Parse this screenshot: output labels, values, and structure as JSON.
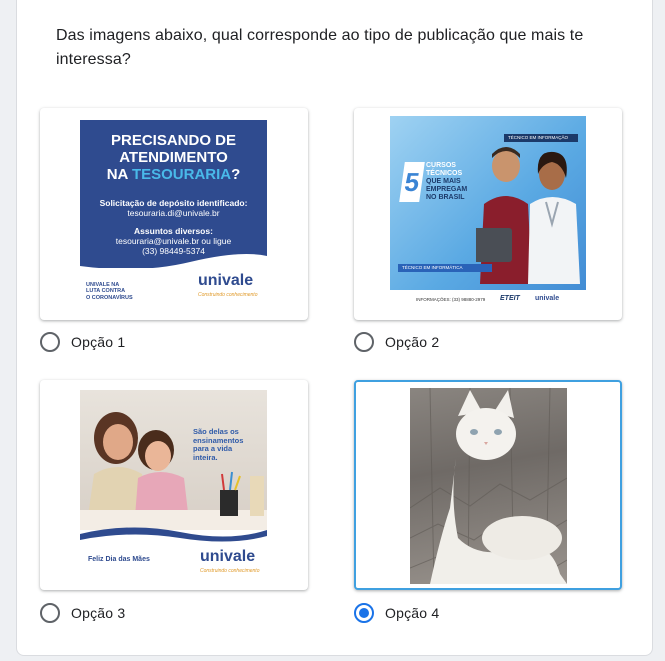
{
  "question": "Das imagens abaixo, qual corresponde ao tipo de publicação que mais te interessa?",
  "options": [
    {
      "label": "Opção 1",
      "selected": false
    },
    {
      "label": "Opção 2",
      "selected": false
    },
    {
      "label": "Opção 3",
      "selected": false
    },
    {
      "label": "Opção 4",
      "selected": true
    }
  ],
  "image1": {
    "title_line1": "PRECISANDO DE",
    "title_line2": "ATENDIMENTO",
    "title_line3_pre": "NA ",
    "title_line3_hl": "TESOURARIA",
    "title_line3_post": "?",
    "deposit_label": "Solicitação de depósito identificado:",
    "deposit_email": "tesouraria.di@univale.br",
    "other_label": "Assuntos diversos:",
    "other_contact": "tesouraria@univale.br ou ligue",
    "other_phone": "(33) 98449-5374",
    "corona_1": "UNIVALE NA",
    "corona_2": "LUTA CONTRA",
    "corona_3": "O CORONAVÍRUS",
    "logo": "univale",
    "tagline": "Construindo conhecimento"
  },
  "image2": {
    "five": "5",
    "line1": "CURSOS",
    "line2": "TÉCNICOS",
    "line3": "QUE MAIS",
    "line4": "EMPREGAM",
    "line5": "NO BRASIL",
    "badge": "TÉCNICO EM INFORMAÇÃO",
    "strip": "TÉCNICO EM INFORMÁTICA",
    "footer": "INFORMAÇÕES: (33) 98880-2979",
    "logo1": "ETEIT",
    "logo2": "univale"
  },
  "image3": {
    "text1": "São delas os",
    "text2": "ensinamentos",
    "text3": "para a vida",
    "text4": "inteira.",
    "feliz": "Feliz Dia das Mães",
    "logo": "univale",
    "tagline": "Construindo conhecimento"
  },
  "colors": {
    "selected_accent": "#1a73e8",
    "selected_border": "#3fa0e0"
  }
}
